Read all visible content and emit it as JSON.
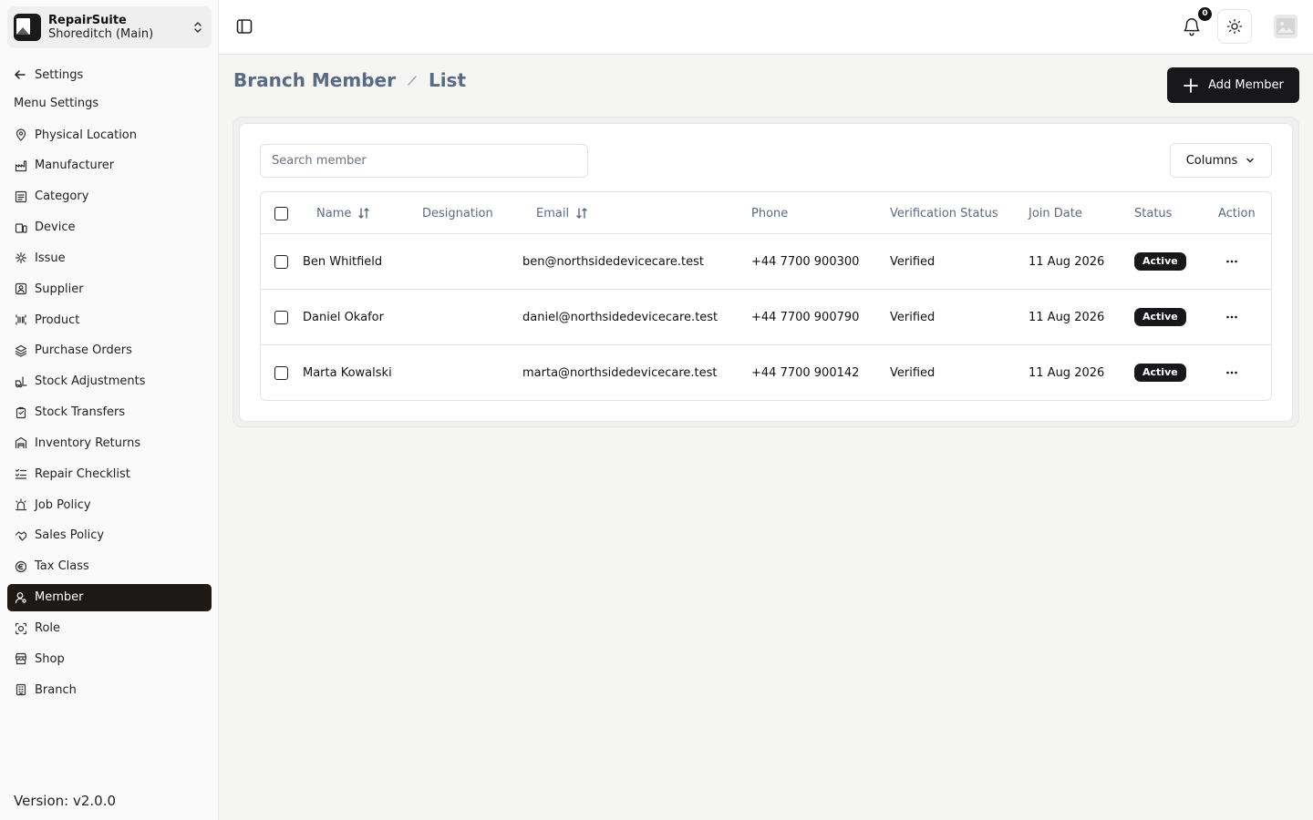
{
  "app": {
    "name": "RepairSuite",
    "branch": "Shoreditch (Main)",
    "version": "Version: v2.0.0"
  },
  "sidebar": {
    "back_label": "Settings",
    "menu_heading": "Menu Settings",
    "items": [
      {
        "label": "Physical Location",
        "icon": "map-pin-icon"
      },
      {
        "label": "Manufacturer",
        "icon": "factory-icon"
      },
      {
        "label": "Category",
        "icon": "category-icon"
      },
      {
        "label": "Device",
        "icon": "device-icon"
      },
      {
        "label": "Issue",
        "icon": "bug-icon"
      },
      {
        "label": "Supplier",
        "icon": "supplier-icon"
      },
      {
        "label": "Product",
        "icon": "barcode-icon"
      },
      {
        "label": "Purchase Orders",
        "icon": "layers-icon"
      },
      {
        "label": "Stock Adjustments",
        "icon": "forklift-icon"
      },
      {
        "label": "Stock Transfers",
        "icon": "clipboard-icon"
      },
      {
        "label": "Inventory Returns",
        "icon": "warehouse-icon"
      },
      {
        "label": "Repair Checklist",
        "icon": "list-checks-icon"
      },
      {
        "label": "Job Policy",
        "icon": "siren-icon"
      },
      {
        "label": "Sales Policy",
        "icon": "handshake-icon"
      },
      {
        "label": "Tax Class",
        "icon": "euro-icon"
      },
      {
        "label": "Member",
        "icon": "user-cog-icon",
        "active": true
      },
      {
        "label": "Role",
        "icon": "scan-face-icon"
      },
      {
        "label": "Shop",
        "icon": "store-icon"
      },
      {
        "label": "Branch",
        "icon": "building-icon"
      }
    ]
  },
  "topbar": {
    "notifications_count": "0"
  },
  "page": {
    "breadcrumb": [
      "Branch Member",
      "List"
    ],
    "add_button": "Add Member",
    "search_placeholder": "Search member",
    "columns_button": "Columns"
  },
  "table": {
    "headers": {
      "name": "Name",
      "designation": "Designation",
      "email": "Email",
      "phone": "Phone",
      "verification": "Verification Status",
      "join_date": "Join Date",
      "status": "Status",
      "action": "Action"
    },
    "rows": [
      {
        "name": "Ben Whitfield",
        "designation": "",
        "email": "ben@northsidedevicecare.test",
        "phone": "+44 7700 900300",
        "verification": "Verified",
        "join_date": "11 Aug 2026",
        "status": "Active"
      },
      {
        "name": "Daniel Okafor",
        "designation": "",
        "email": "daniel@northsidedevicecare.test",
        "phone": "+44 7700 900790",
        "verification": "Verified",
        "join_date": "11 Aug 2026",
        "status": "Active"
      },
      {
        "name": "Marta Kowalski",
        "designation": "",
        "email": "marta@northsidedevicecare.test",
        "phone": "+44 7700 900142",
        "verification": "Verified",
        "join_date": "11 Aug 2026",
        "status": "Active"
      }
    ]
  },
  "colors": {
    "primary": "#18181b",
    "muted_text": "#5b6a83",
    "page_bg": "#f5f5f4",
    "border": "#e3e3e3"
  }
}
